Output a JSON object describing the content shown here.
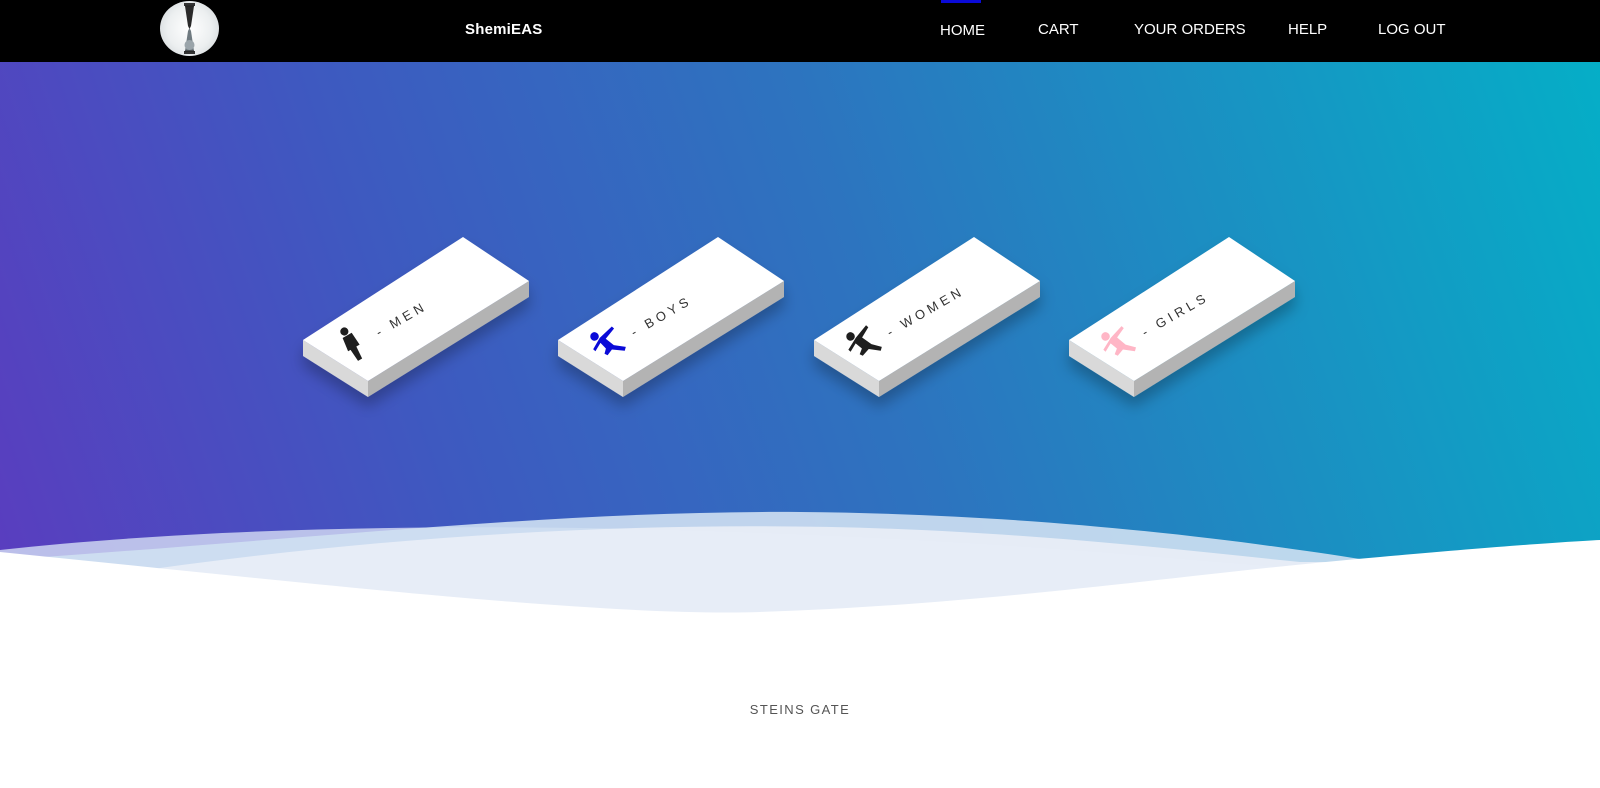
{
  "nav": {
    "brand": "ShemiEAS",
    "links": [
      {
        "label": "HOME",
        "active": true
      },
      {
        "label": "CART",
        "active": false
      },
      {
        "label": "YOUR ORDERS",
        "active": false
      },
      {
        "label": "HELP",
        "active": false
      },
      {
        "label": "LOG OUT",
        "active": false
      }
    ],
    "active_color": "#0a0ad8"
  },
  "hero": {
    "gradient": [
      "#5b3cbf",
      "#3e59c0",
      "#2d74bf",
      "#1795c3",
      "#05aec7"
    ]
  },
  "categories": [
    {
      "label": "- MEN",
      "icon": "man-icon",
      "icon_color": "#1e1e1e"
    },
    {
      "label": "- BOYS",
      "icon": "boy-icon",
      "icon_color": "#0a0ad8"
    },
    {
      "label": "- WOMEN",
      "icon": "woman-icon",
      "icon_color": "#1e1e1e"
    },
    {
      "label": "- GIRLS",
      "icon": "girl-icon",
      "icon_color": "#ffb6c6"
    }
  ],
  "footer": {
    "text": "STEINS GATE"
  }
}
